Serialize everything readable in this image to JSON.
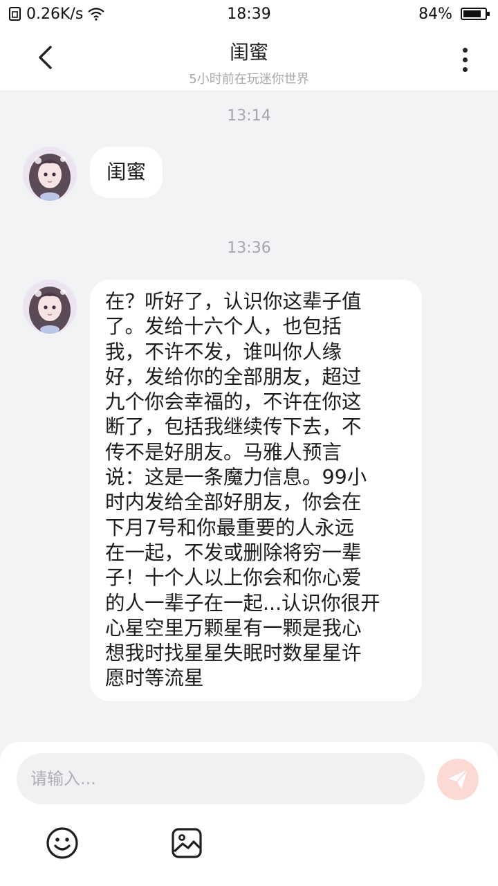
{
  "status_bar": {
    "net_speed": "0.26K/s",
    "time": "18:39",
    "battery": "84%",
    "battery_level": 0.84,
    "icons": [
      "sim-icon",
      "wifi-icon",
      "battery-icon"
    ]
  },
  "header": {
    "title": "闺蜜",
    "subtitle": "5小时前在玩迷你世界",
    "icons": [
      "back-icon",
      "more-icon"
    ]
  },
  "messages": [
    {
      "timestamp": "13:14",
      "text": "闺蜜"
    },
    {
      "timestamp": "13:36",
      "lines": [
        "在？听好了，认识你这辈子值",
        "了。发给十六个人，也包括",
        "我，不许不发，谁叫你人缘",
        "好，发给你的全部朋友，超过",
        "九个你会幸福的，不许在你这",
        "断了，包括我继续传下去，不",
        "传不是好朋友。马雅人预言",
        "说：这是一条魔力信息。99小",
        "时内发给全部好朋友，你会在",
        "下月7号和你最重要的人永远",
        "在一起，不发或删除将穷一辈",
        "子！十个人以上你会和你心爱",
        "的人一辈子在一起...认识你很开",
        "心星空里万颗星有一颗是我心",
        "想我时找星星失眠时数星星许",
        "愿时等流星"
      ]
    }
  ],
  "input": {
    "placeholder": "请输入...",
    "icons": [
      "send-icon",
      "emoji-icon",
      "image-icon"
    ]
  },
  "colors": {
    "background": "#f2f3f5",
    "bubble": "#ffffff",
    "send_button": "#fcd9d3",
    "send_icon": "#ffffff",
    "muted_text": "#a6a6aa"
  }
}
